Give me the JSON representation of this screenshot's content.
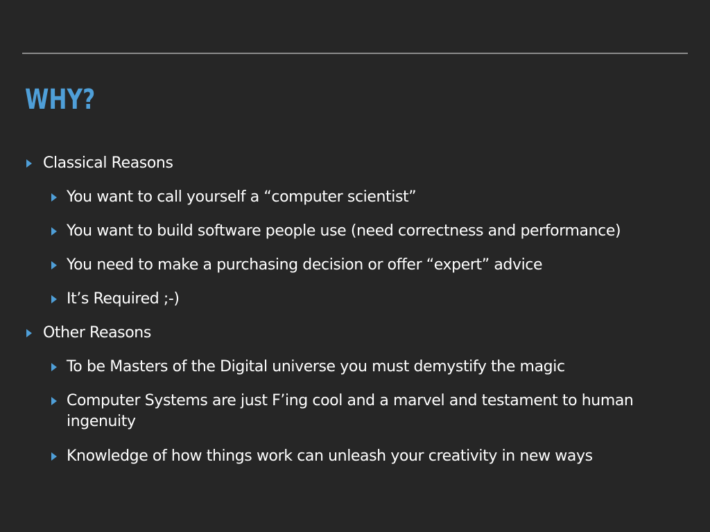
{
  "slide": {
    "title": "WHY?",
    "accent_color": "#4f9fd8",
    "background_color": "#262626",
    "bullets": [
      {
        "level": 1,
        "icon": "triangle-right-icon",
        "text": "Classical Reasons"
      },
      {
        "level": 2,
        "icon": "triangle-right-icon",
        "text": "You want to call yourself a “computer scientist”"
      },
      {
        "level": 2,
        "icon": "triangle-right-icon",
        "text": "You want to build software people use (need correctness and performance)"
      },
      {
        "level": 2,
        "icon": "triangle-right-icon",
        "text": "You need to make a purchasing decision or offer “expert” advice"
      },
      {
        "level": 2,
        "icon": "triangle-right-icon",
        "text": "It’s Required ;-)"
      },
      {
        "level": 1,
        "icon": "triangle-right-icon",
        "text": "Other Reasons"
      },
      {
        "level": 2,
        "icon": "triangle-right-icon",
        "text": "To be Masters of the Digital universe you must demystify the magic"
      },
      {
        "level": 2,
        "icon": "triangle-right-icon",
        "text": "Computer Systems are just F’ing cool and a marvel and testament to human ingenuity"
      },
      {
        "level": 2,
        "icon": "triangle-right-icon",
        "text": "Knowledge of how things work can unleash your creativity in new ways"
      }
    ]
  }
}
